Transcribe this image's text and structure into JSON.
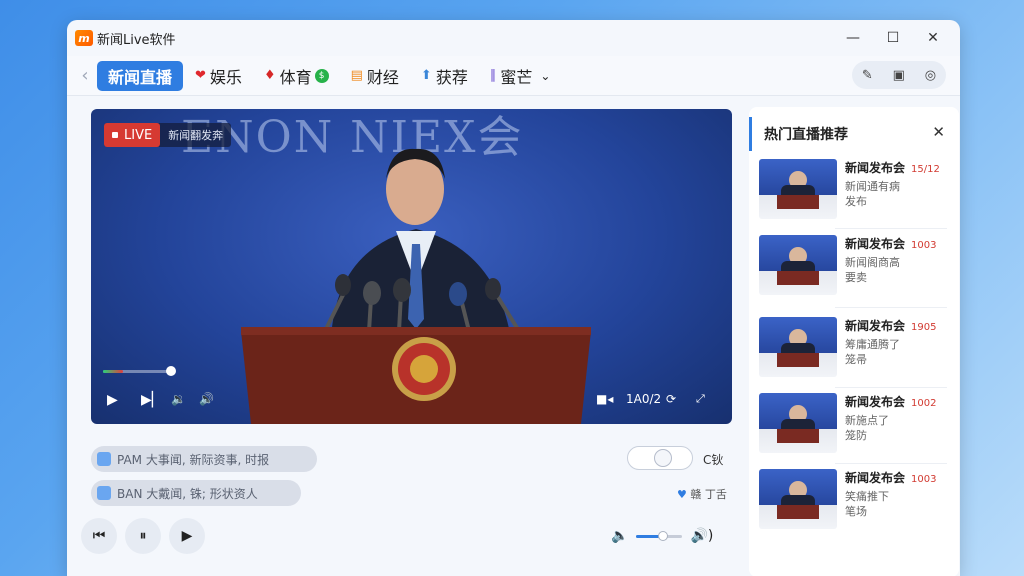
{
  "app": {
    "logo_char": "m",
    "title": "新闻Live软件"
  },
  "window_controls": {
    "minimize": "—",
    "maximize": "☐",
    "close": "✕"
  },
  "tabs": [
    {
      "label": "新闻直播",
      "icon": ""
    },
    {
      "label": "娱乐",
      "icon": "heart-icon"
    },
    {
      "label": "体育",
      "icon": "sports-icon"
    },
    {
      "label": "财经",
      "icon": "finance-icon"
    },
    {
      "label": "获荐",
      "icon": "pin-icon"
    },
    {
      "label": "蜜芒",
      "icon": "bars-icon"
    }
  ],
  "video": {
    "backdrop_text": "ENON NIEX会",
    "live_label": "LIVE",
    "live_title": "新闻翻发奔",
    "time": "1A0/2",
    "progress": 0.3
  },
  "captions": [
    {
      "text": "PAM 大事闻, 新际资事, 时报"
    },
    {
      "text": "BAN 大戴闻, 铢; 形状资人"
    }
  ],
  "toggle_label": "C钬",
  "like_label": "赣 丁舌",
  "volume_level": 0.55,
  "panel": {
    "title": "热门直播推荐",
    "items": [
      {
        "title": "新闻发布会",
        "count": "15/12",
        "desc1": "新闻通有病",
        "desc2": "发布"
      },
      {
        "title": "新闻发布会",
        "count": "1003",
        "desc1": "新闻阁商高",
        "desc2": "要卖"
      },
      {
        "title": "新闻发布会",
        "count": "1905",
        "desc1": "筹庸通腾了",
        "desc2": "笼帚"
      },
      {
        "title": "新闻发布会",
        "count": "1002",
        "desc1": "新施点了",
        "desc2": "笼防"
      },
      {
        "title": "新闻发布会",
        "count": "1003",
        "desc1": "笑痛推下",
        "desc2": "笔场"
      }
    ]
  }
}
